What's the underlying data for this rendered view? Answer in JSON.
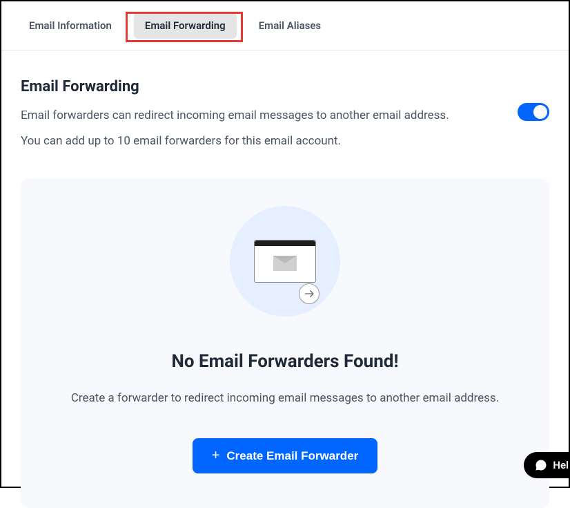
{
  "tabs": {
    "info": "Email Information",
    "forwarding": "Email Forwarding",
    "aliases": "Email Aliases"
  },
  "header": {
    "title": "Email Forwarding",
    "desc1": "Email forwarders can redirect incoming email messages to another email address.",
    "desc2": "You can add up to 10 email forwarders for this email account."
  },
  "empty": {
    "title": "No Email Forwarders Found!",
    "desc": "Create a forwarder to redirect incoming email messages to another email address.",
    "button": "Create Email Forwarder"
  },
  "help": {
    "label": "Hel"
  }
}
